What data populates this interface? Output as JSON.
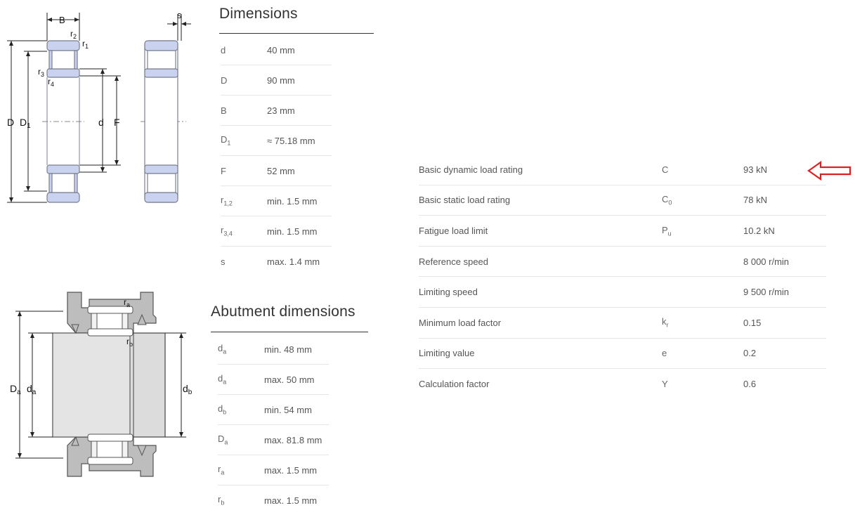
{
  "drawing_top": {
    "labels": {
      "B": "B",
      "s": "s",
      "r2": "r",
      "r2_sub": "2",
      "r1": "r",
      "r1_sub": "1",
      "r3": "r",
      "r3_sub": "3",
      "r4": "r",
      "r4_sub": "4",
      "D": "D",
      "D1": "D",
      "D1_sub": "1",
      "d": "d",
      "F": "F"
    }
  },
  "drawing_bottom": {
    "labels": {
      "ra": "r",
      "ra_sub": "a",
      "rb": "r",
      "rb_sub": "b",
      "Da": "D",
      "Da_sub": "a",
      "da": "d",
      "da_sub": "a",
      "db": "d",
      "db_sub": "b"
    }
  },
  "dimensions": {
    "title": "Dimensions",
    "rows": [
      {
        "sym": "d",
        "sub": "",
        "value": "40 mm"
      },
      {
        "sym": "D",
        "sub": "",
        "value": "90 mm"
      },
      {
        "sym": "B",
        "sub": "",
        "value": "23 mm"
      },
      {
        "sym": "D",
        "sub": "1",
        "value": "≈ 75.18 mm"
      },
      {
        "sym": "F",
        "sub": "",
        "value": "52 mm"
      },
      {
        "sym": "r",
        "sub": "1,2",
        "value": "min. 1.5 mm"
      },
      {
        "sym": "r",
        "sub": "3,4",
        "value": "min. 1.5 mm"
      },
      {
        "sym": "s",
        "sub": "",
        "value": "max. 1.4 mm"
      }
    ]
  },
  "abutment": {
    "title": "Abutment dimensions",
    "rows": [
      {
        "sym": "d",
        "sub": "a",
        "value": "min. 48 mm"
      },
      {
        "sym": "d",
        "sub": "a",
        "value": "max. 50 mm"
      },
      {
        "sym": "d",
        "sub": "b",
        "value": "min. 54 mm"
      },
      {
        "sym": "D",
        "sub": "a",
        "value": "max. 81.8 mm"
      },
      {
        "sym": "r",
        "sub": "a",
        "value": "max. 1.5 mm"
      },
      {
        "sym": "r",
        "sub": "b",
        "value": "max. 1.5 mm"
      }
    ]
  },
  "load_ratings": {
    "rows": [
      {
        "name": "Basic dynamic load rating",
        "sym": "C",
        "sub": "",
        "value": "93 kN"
      },
      {
        "name": "Basic static load rating",
        "sym": "C",
        "sub": "0",
        "value": "78 kN"
      },
      {
        "name": "Fatigue load limit",
        "sym": "P",
        "sub": "u",
        "value": "10.2 kN"
      },
      {
        "name": "Reference speed",
        "sym": "",
        "sub": "",
        "value": "8 000 r/min"
      },
      {
        "name": "Limiting speed",
        "sym": "",
        "sub": "",
        "value": "9 500 r/min"
      },
      {
        "name": "Minimum load factor",
        "sym": "k",
        "sub": "r",
        "value": "0.15"
      },
      {
        "name": "Limiting value",
        "sym": "e",
        "sub": "",
        "value": "0.2"
      },
      {
        "name": "Calculation factor",
        "sym": "Y",
        "sub": "",
        "value": "0.6"
      }
    ]
  },
  "annotation": {
    "icon": "red-outline-arrow-left-icon",
    "color": "#e02020"
  },
  "colors": {
    "bearing_fill": "#c9d3f0",
    "bearing_stroke": "#7a7f8c",
    "housing_fill": "#bdbdbd",
    "shaft_fill": "#dcdcdc"
  }
}
